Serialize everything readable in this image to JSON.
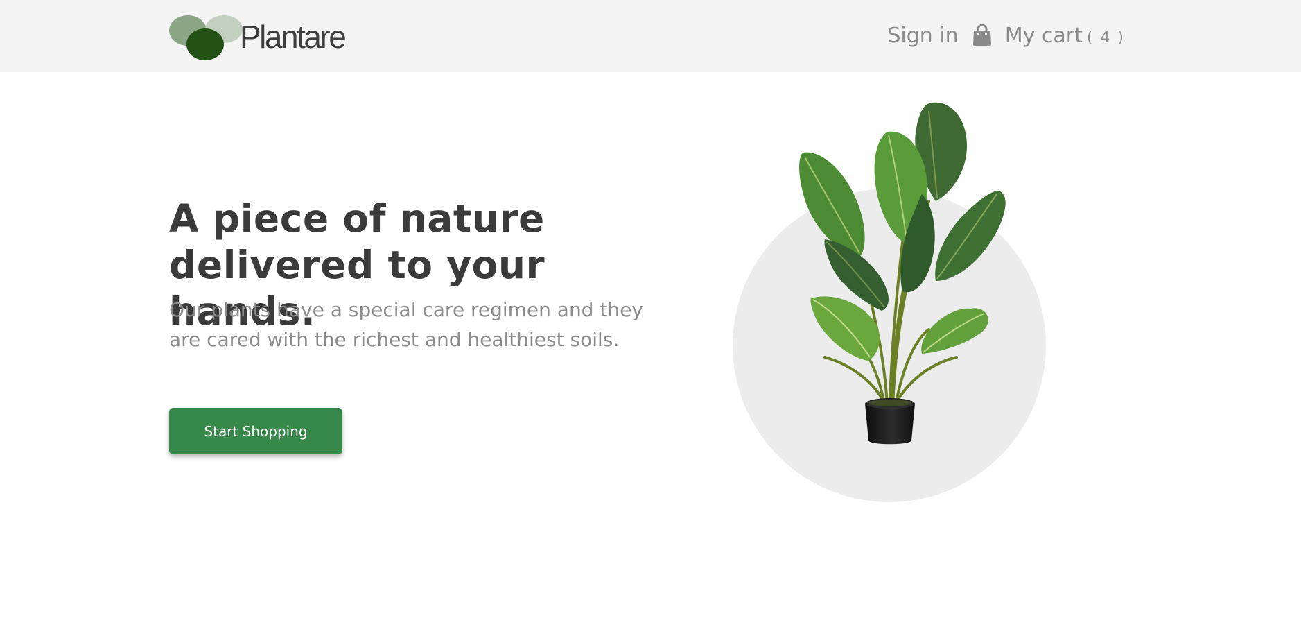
{
  "header": {
    "brand": "Plantare",
    "sign_in": "Sign in",
    "cart_label": "My cart",
    "cart_count": "( 4 )",
    "icons": {
      "logo": "plantare-logo",
      "cart": "shopping-bag-icon"
    }
  },
  "hero": {
    "headline": "A piece of nature delivered to your hands.",
    "description": "Our plants have a special care regimen and they are cared with the richest and healthiest soils.",
    "cta_label": "Start Shopping",
    "image": "potted-plant-illustration"
  },
  "colors": {
    "header_bg": "#f4f4f4",
    "text_dark": "#3b3b3b",
    "text_muted": "#8a8a8a",
    "primary_green": "#37894a",
    "logo_dark": "#235116",
    "logo_mid": "#8aa684",
    "logo_light": "#c3d0bf",
    "circle_bg": "#ececec"
  }
}
